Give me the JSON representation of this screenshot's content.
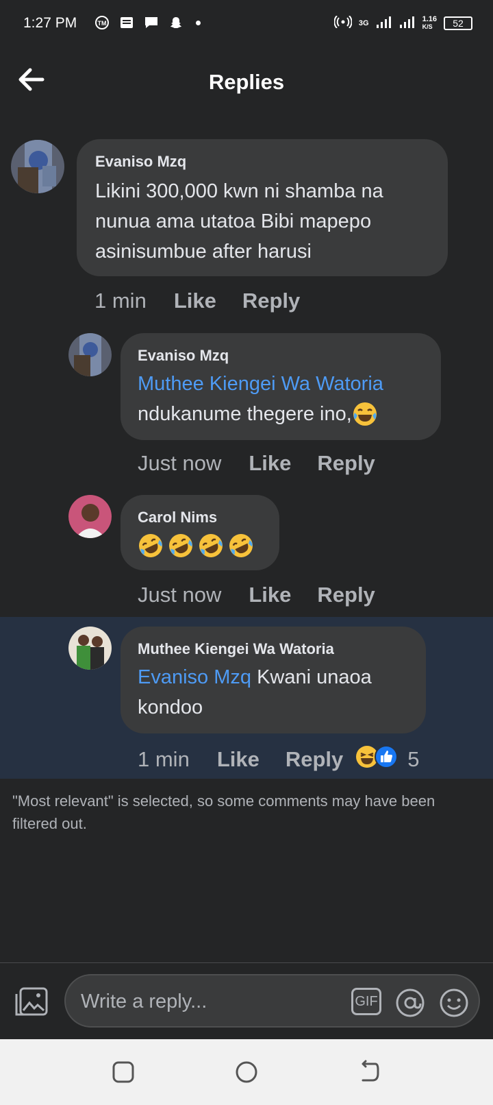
{
  "status_bar": {
    "time": "1:27 PM",
    "network": "3G",
    "speed_value": "1.16",
    "speed_unit": "K/S",
    "battery": "52"
  },
  "header": {
    "title": "Replies"
  },
  "comments": [
    {
      "author": "Evaniso Mzq",
      "text": "Likini 300,000 kwn ni shamba na nunua ama utatoa Bibi mapepo asinisumbue after harusi",
      "time": "1 min",
      "like_label": "Like",
      "reply_label": "Reply"
    },
    {
      "author": "Evaniso Mzq",
      "mention": "Muthee Kiengei Wa Watoria",
      "text": "ndukanume thegere ino,",
      "emoji": "tears-of-joy",
      "time": "Just now",
      "like_label": "Like",
      "reply_label": "Reply"
    },
    {
      "author": "Carol Nims",
      "emoji": "rolling-on-floor-laughing x4",
      "time": "Just now",
      "like_label": "Like",
      "reply_label": "Reply"
    },
    {
      "author": "Muthee Kiengei Wa Watoria",
      "mention": "Evaniso Mzq",
      "text": "Kwani unaoa kondoo",
      "time": "1 min",
      "like_label": "Like",
      "reply_label": "Reply",
      "reaction_count": "5"
    }
  ],
  "filter_note": "\"Most relevant\" is selected, so some comments may have been filtered out.",
  "composer": {
    "placeholder": "Write a reply...",
    "gif_label": "GIF"
  },
  "colors": {
    "background": "#242526",
    "bubble": "#3a3b3c",
    "mention": "#4e9bf5",
    "highlight": "#263142"
  }
}
